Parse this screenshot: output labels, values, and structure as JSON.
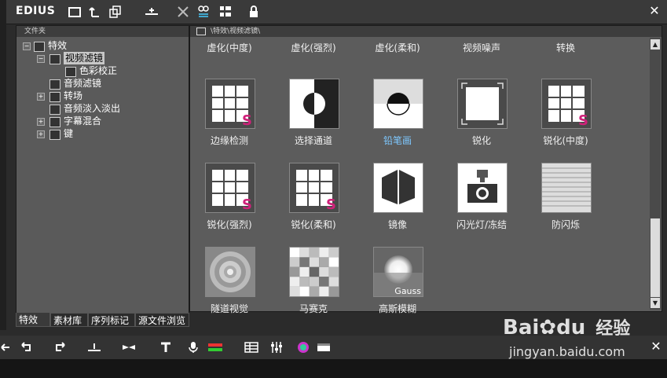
{
  "app": {
    "title": "EDIUS"
  },
  "toolbar": {
    "icons": [
      "folder-icon",
      "up-folder-icon",
      "copy-icon",
      "timeline-icon",
      "cut-icon",
      "properties-icon",
      "view-icon",
      "lock-icon"
    ]
  },
  "folder_pane": {
    "header": "文件夹",
    "tree": [
      {
        "label": "特效",
        "level": 0
      },
      {
        "label": "视频滤镜",
        "level": 1,
        "selected": true
      },
      {
        "label": "色彩校正",
        "level": 2
      },
      {
        "label": "音频滤镜",
        "level": 1
      },
      {
        "label": "转场",
        "level": 1
      },
      {
        "label": "音频淡入淡出",
        "level": 1
      },
      {
        "label": "字幕混合",
        "level": 1
      },
      {
        "label": "键",
        "level": 1
      }
    ],
    "tabs": [
      "特效",
      "素材库",
      "序列标记",
      "源文件浏览"
    ]
  },
  "content_pane": {
    "path": "\\特效\\视频滤镜\\",
    "top_row": [
      "虚化(中度)",
      "虚化(强烈)",
      "虚化(柔和)",
      "视频噪声",
      "转换"
    ],
    "rows": [
      [
        "边缘检测",
        "选择通道",
        "铅笔画",
        "锐化",
        "锐化(中度)"
      ],
      [
        "锐化(强烈)",
        "锐化(柔和)",
        "镜像",
        "闪光灯/冻结",
        "防闪烁"
      ],
      [
        "隧道视觉",
        "马赛克",
        "高斯模糊"
      ]
    ],
    "gauss_label": "Gauss"
  },
  "watermark": {
    "brand": "Bai",
    "brand2": "du",
    "text": "经验",
    "url": "jingyan.baidu.com"
  }
}
